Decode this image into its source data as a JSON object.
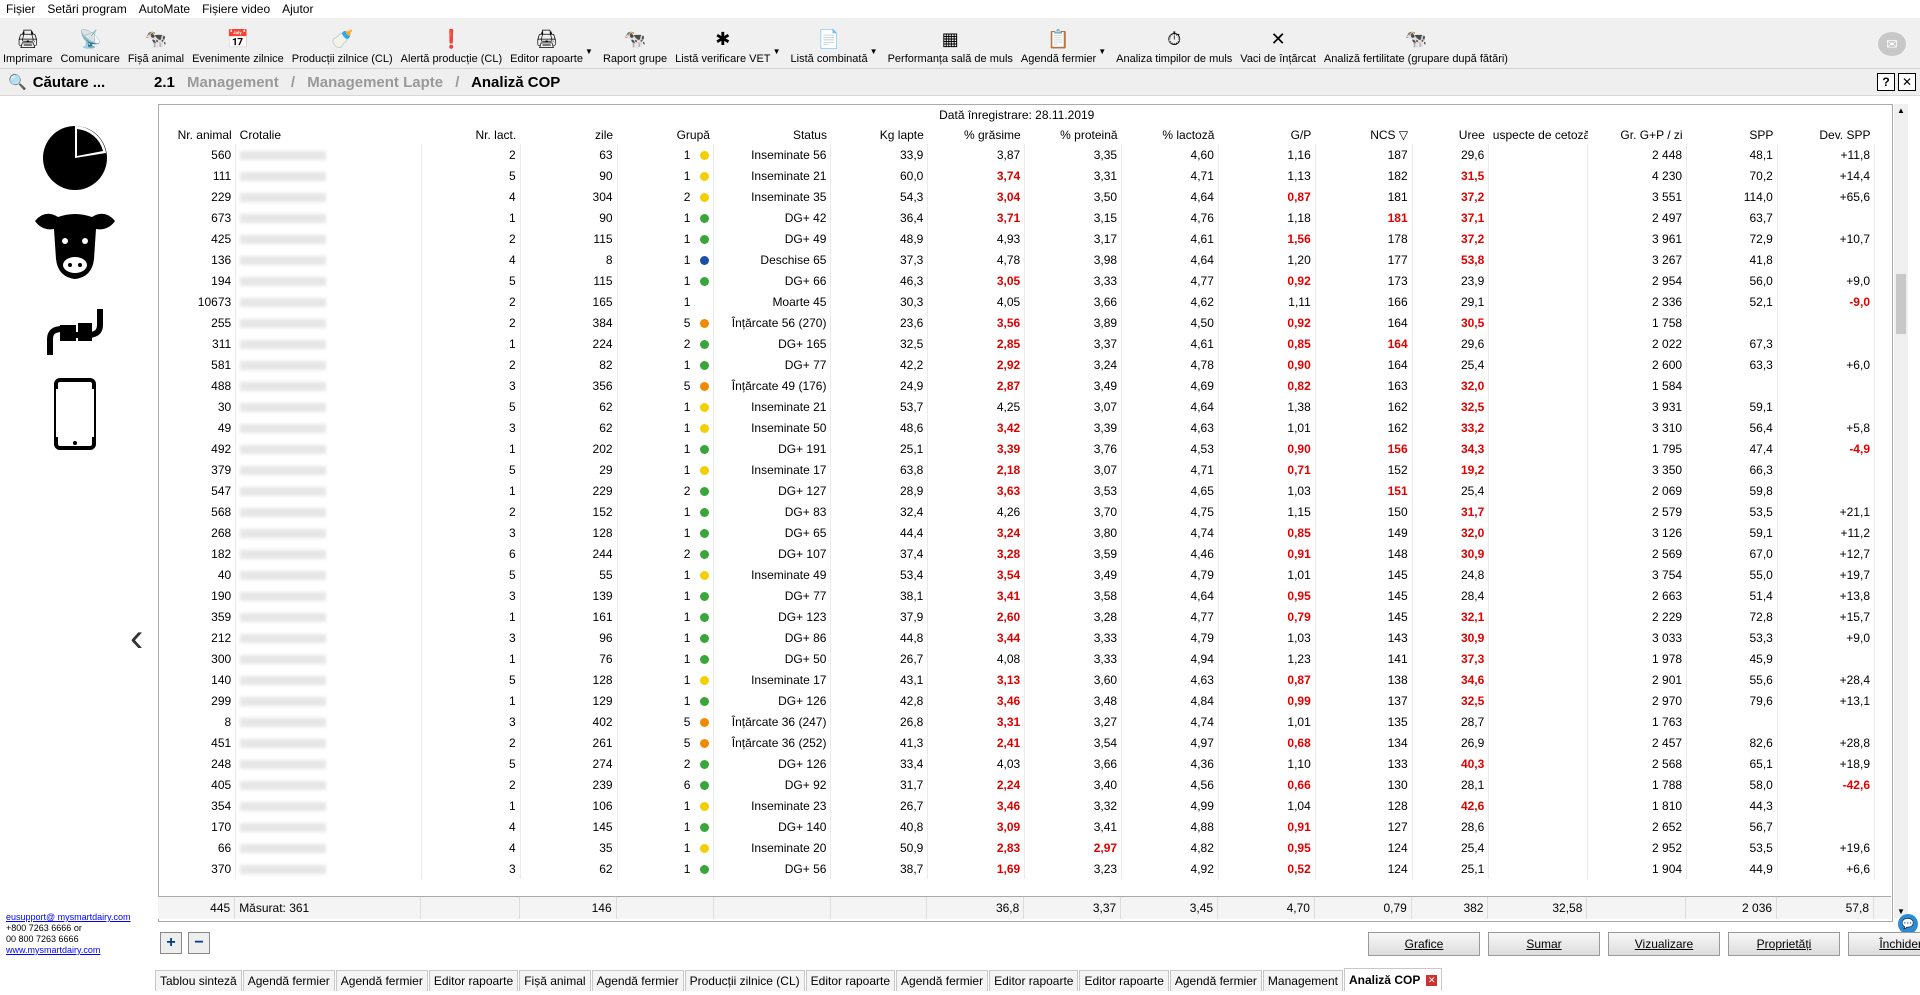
{
  "menu": [
    "Fișier",
    "Setări program",
    "AutoMate",
    "Fișiere video",
    "Ajutor"
  ],
  "toolbar": [
    {
      "label": "Imprimare",
      "icon": "printer-icon",
      "glyph": "🖨",
      "dd": false
    },
    {
      "label": "Comunicare",
      "icon": "antenna-icon",
      "glyph": "📡",
      "dd": false
    },
    {
      "label": "Fișă animal",
      "icon": "cow-card-icon",
      "glyph": "🐄",
      "dd": false
    },
    {
      "label": "Evenimente zilnice",
      "icon": "calendar-icon",
      "glyph": "📅",
      "dd": false
    },
    {
      "label": "Producții zilnice (CL)",
      "icon": "milk-bottle-icon",
      "glyph": "🍼",
      "dd": false
    },
    {
      "label": "Alertă producție (CL)",
      "icon": "alert-bottle-icon",
      "glyph": "❗",
      "dd": false
    },
    {
      "label": "Editor rapoarte",
      "icon": "report-printer-icon",
      "glyph": "🖨",
      "dd": true
    },
    {
      "label": "Raport grupe",
      "icon": "group-report-icon",
      "glyph": "🐄",
      "dd": false
    },
    {
      "label": "Listă verificare VET",
      "icon": "vet-icon",
      "glyph": "✱",
      "dd": true
    },
    {
      "label": "Listă combinată",
      "icon": "combined-list-icon",
      "glyph": "📄",
      "dd": true
    },
    {
      "label": "Performanța sală de muls",
      "icon": "milking-parlor-icon",
      "glyph": "▦",
      "dd": false
    },
    {
      "label": "Agendă fermier",
      "icon": "agenda-icon",
      "glyph": "📋",
      "dd": true
    },
    {
      "label": "Analiza timpilor de muls",
      "icon": "milking-time-icon",
      "glyph": "⏱",
      "dd": false
    },
    {
      "label": "Vaci de înțărcat",
      "icon": "dry-off-icon",
      "glyph": "✕",
      "dd": false
    },
    {
      "label": "Analiză fertilitate (grupare după fătări)",
      "icon": "fertility-icon",
      "glyph": "🐄",
      "dd": false
    }
  ],
  "search": {
    "label": "Căutare ..."
  },
  "breadcrumb": {
    "num": "2.1",
    "items": [
      "Management",
      "Management Lapte"
    ],
    "current": "Analiză COP"
  },
  "window_buttons": {
    "help": "?",
    "close": "✕"
  },
  "support": {
    "email": "eusupport@ mysmartdairy.com",
    "phone1": "+800 7263 6666 or",
    "phone2": "00 800 7263 6666",
    "site": "www.mysmartdairy.com"
  },
  "grid": {
    "date_label": "Dată înregistrare: 28.11.2019",
    "columns": [
      "Nr. animal",
      "Crotalie",
      "Nr. lact.",
      "zile",
      "Grupă",
      "Status",
      "Kg lapte",
      "% grăsime",
      "% proteină",
      "% lactoză",
      "G/P",
      "NCS ▽",
      "Uree",
      "uspecte de cetoză",
      "Gr. G+P / zi",
      "SPP",
      "Dev. SPP"
    ],
    "rows": [
      [
        "560",
        "",
        "2",
        "63",
        "1",
        "Y",
        "Inseminate 56",
        "33,9",
        "3,87",
        "3,35",
        "4,60",
        "1,16",
        "187",
        "29,6",
        "2 448",
        "48,1",
        "+11,8"
      ],
      [
        "111",
        "",
        "5",
        "90",
        "1",
        "Y",
        "Inseminate 21",
        "60,0",
        "*3,74",
        "3,31",
        "4,71",
        "1,13",
        "182",
        "*31,5",
        "4 230",
        "70,2",
        "+14,4"
      ],
      [
        "229",
        "",
        "4",
        "304",
        "2",
        "Y",
        "Inseminate 35",
        "54,3",
        "*3,04",
        "3,50",
        "4,64",
        "*0,87",
        "181",
        "*37,2",
        "3 551",
        "114,0",
        "+65,6"
      ],
      [
        "673",
        "",
        "1",
        "90",
        "1",
        "G",
        "DG+ 42",
        "36,4",
        "*3,71",
        "3,15",
        "4,76",
        "1,18",
        "*181",
        "*37,1",
        "2 497",
        "63,7",
        ""
      ],
      [
        "425",
        "",
        "2",
        "115",
        "1",
        "G",
        "DG+ 49",
        "48,9",
        "4,93",
        "3,17",
        "4,61",
        "*1,56",
        "178",
        "*37,2",
        "3 961",
        "72,9",
        "+10,7"
      ],
      [
        "136",
        "",
        "4",
        "8",
        "1",
        "B",
        "Deschise 65",
        "37,3",
        "4,78",
        "3,98",
        "4,64",
        "1,20",
        "177",
        "*53,8",
        "3 267",
        "41,8",
        ""
      ],
      [
        "194",
        "",
        "5",
        "115",
        "1",
        "G",
        "DG+ 66",
        "46,3",
        "*3,05",
        "3,33",
        "4,77",
        "*0,92",
        "173",
        "23,9",
        "2 954",
        "56,0",
        "+9,0"
      ],
      [
        "10673",
        "",
        "2",
        "165",
        "1",
        "",
        "Moarte 45",
        "30,3",
        "4,05",
        "3,66",
        "4,62",
        "1,11",
        "166",
        "29,1",
        "2 336",
        "52,1",
        "*-9,0"
      ],
      [
        "255",
        "",
        "2",
        "384",
        "5",
        "O",
        "Înțărcate 56 (270)",
        "23,6",
        "*3,56",
        "3,89",
        "4,50",
        "*0,92",
        "164",
        "*30,5",
        "1 758",
        "",
        ""
      ],
      [
        "311",
        "",
        "1",
        "224",
        "2",
        "G",
        "DG+ 165",
        "32,5",
        "*2,85",
        "3,37",
        "4,61",
        "*0,85",
        "*164",
        "29,6",
        "2 022",
        "67,3",
        ""
      ],
      [
        "581",
        "",
        "2",
        "82",
        "1",
        "G",
        "DG+ 77",
        "42,2",
        "*2,92",
        "3,24",
        "4,78",
        "*0,90",
        "164",
        "25,4",
        "2 600",
        "63,3",
        "+6,0"
      ],
      [
        "488",
        "",
        "3",
        "356",
        "5",
        "O",
        "Înțărcate 49 (176)",
        "24,9",
        "*2,87",
        "3,49",
        "4,69",
        "*0,82",
        "163",
        "*32,0",
        "1 584",
        "",
        ""
      ],
      [
        "30",
        "",
        "5",
        "62",
        "1",
        "Y",
        "Inseminate 21",
        "53,7",
        "4,25",
        "3,07",
        "4,64",
        "1,38",
        "162",
        "*32,5",
        "3 931",
        "59,1",
        ""
      ],
      [
        "49",
        "",
        "3",
        "62",
        "1",
        "Y",
        "Inseminate 50",
        "48,6",
        "*3,42",
        "3,39",
        "4,63",
        "1,01",
        "162",
        "*33,2",
        "3 310",
        "56,4",
        "+5,8"
      ],
      [
        "492",
        "",
        "1",
        "202",
        "1",
        "G",
        "DG+ 191",
        "25,1",
        "*3,39",
        "3,76",
        "4,53",
        "*0,90",
        "*156",
        "*34,3",
        "1 795",
        "47,4",
        "*-4,9"
      ],
      [
        "379",
        "",
        "5",
        "29",
        "1",
        "Y",
        "Inseminate 17",
        "63,8",
        "*2,18",
        "3,07",
        "4,71",
        "*0,71",
        "152",
        "*19,2",
        "3 350",
        "66,3",
        ""
      ],
      [
        "547",
        "",
        "1",
        "229",
        "2",
        "G",
        "DG+ 127",
        "28,9",
        "*3,63",
        "3,53",
        "4,65",
        "1,03",
        "*151",
        "25,4",
        "2 069",
        "59,8",
        ""
      ],
      [
        "568",
        "",
        "2",
        "152",
        "1",
        "G",
        "DG+ 83",
        "32,4",
        "4,26",
        "3,70",
        "4,75",
        "1,15",
        "150",
        "*31,7",
        "2 579",
        "53,5",
        "+21,1"
      ],
      [
        "268",
        "",
        "3",
        "128",
        "1",
        "G",
        "DG+ 65",
        "44,4",
        "*3,24",
        "3,80",
        "4,74",
        "*0,85",
        "149",
        "*32,0",
        "3 126",
        "59,1",
        "+11,2"
      ],
      [
        "182",
        "",
        "6",
        "244",
        "2",
        "G",
        "DG+ 107",
        "37,4",
        "*3,28",
        "3,59",
        "4,46",
        "*0,91",
        "148",
        "*30,9",
        "2 569",
        "67,0",
        "+12,7"
      ],
      [
        "40",
        "",
        "5",
        "55",
        "1",
        "Y",
        "Inseminate 49",
        "53,4",
        "*3,54",
        "3,49",
        "4,79",
        "1,01",
        "145",
        "24,8",
        "3 754",
        "55,0",
        "+19,7"
      ],
      [
        "190",
        "",
        "3",
        "139",
        "1",
        "G",
        "DG+ 77",
        "38,1",
        "*3,41",
        "3,58",
        "4,64",
        "*0,95",
        "145",
        "28,4",
        "2 663",
        "51,4",
        "+13,8"
      ],
      [
        "359",
        "",
        "1",
        "161",
        "1",
        "G",
        "DG+ 123",
        "37,9",
        "*2,60",
        "3,28",
        "4,77",
        "*0,79",
        "145",
        "*32,1",
        "2 229",
        "72,8",
        "+15,7"
      ],
      [
        "212",
        "",
        "3",
        "96",
        "1",
        "G",
        "DG+ 86",
        "44,8",
        "*3,44",
        "3,33",
        "4,79",
        "1,03",
        "143",
        "*30,9",
        "3 033",
        "53,3",
        "+9,0"
      ],
      [
        "300",
        "",
        "1",
        "76",
        "1",
        "G",
        "DG+ 50",
        "26,7",
        "4,08",
        "3,33",
        "4,94",
        "1,23",
        "141",
        "*37,3",
        "1 978",
        "45,9",
        ""
      ],
      [
        "140",
        "",
        "5",
        "128",
        "1",
        "Y",
        "Inseminate 17",
        "43,1",
        "*3,13",
        "3,60",
        "4,63",
        "*0,87",
        "138",
        "*34,6",
        "2 901",
        "55,6",
        "+28,4"
      ],
      [
        "299",
        "",
        "1",
        "129",
        "1",
        "G",
        "DG+ 126",
        "42,8",
        "*3,46",
        "3,48",
        "4,84",
        "*0,99",
        "137",
        "*32,5",
        "2 970",
        "79,6",
        "+13,1"
      ],
      [
        "8",
        "",
        "3",
        "402",
        "5",
        "O",
        "Înțărcate 36 (247)",
        "26,8",
        "*3,31",
        "3,27",
        "4,74",
        "1,01",
        "135",
        "28,7",
        "1 763",
        "",
        ""
      ],
      [
        "451",
        "",
        "2",
        "261",
        "5",
        "O",
        "Înțărcate 36 (252)",
        "41,3",
        "*2,41",
        "3,54",
        "4,97",
        "*0,68",
        "134",
        "26,9",
        "2 457",
        "82,6",
        "+28,8"
      ],
      [
        "248",
        "",
        "5",
        "274",
        "2",
        "G",
        "DG+ 126",
        "33,4",
        "4,03",
        "3,66",
        "4,36",
        "1,10",
        "133",
        "*40,3",
        "2 568",
        "65,1",
        "+18,9"
      ],
      [
        "405",
        "",
        "2",
        "239",
        "6",
        "G",
        "DG+ 92",
        "31,7",
        "*2,24",
        "3,40",
        "4,56",
        "*0,66",
        "130",
        "28,1",
        "1 788",
        "58,0",
        "*-42,6"
      ],
      [
        "354",
        "",
        "1",
        "106",
        "1",
        "Y",
        "Inseminate 23",
        "26,7",
        "*3,46",
        "3,32",
        "4,99",
        "1,04",
        "128",
        "*42,6",
        "1 810",
        "44,3",
        ""
      ],
      [
        "170",
        "",
        "4",
        "145",
        "1",
        "G",
        "DG+ 140",
        "40,8",
        "*3,09",
        "3,41",
        "4,88",
        "*0,91",
        "127",
        "28,6",
        "2 652",
        "56,7",
        ""
      ],
      [
        "66",
        "",
        "4",
        "35",
        "1",
        "Y",
        "Inseminate 20",
        "50,9",
        "*2,83",
        "*2,97",
        "4,82",
        "*0,95",
        "124",
        "25,4",
        "2 952",
        "53,5",
        "+19,6"
      ],
      [
        "370",
        "",
        "3",
        "62",
        "1",
        "G",
        "DG+ 56",
        "38,7",
        "*1,69",
        "3,23",
        "4,92",
        "*0,52",
        "124",
        "25,1",
        "1 904",
        "44,9",
        "+6,6"
      ]
    ],
    "totals": [
      "445",
      "Măsurat: 361",
      "",
      "146",
      "",
      "",
      "",
      "36,8",
      "3,37",
      "3,45",
      "4,70",
      "0,79",
      "382",
      "32,58",
      "",
      "2 036",
      "57,8",
      ""
    ]
  },
  "status_colors": {
    "Y": "#f2d000",
    "G": "#3aa53a",
    "B": "#1c4fa8",
    "O": "#f08a00"
  },
  "actions": {
    "add": "+",
    "remove": "−",
    "grafice": "Grafice",
    "sumar": "Sumar",
    "vizualizare": "Vizualizare",
    "proprietati": "Proprietăți",
    "inchidere": "Închidere"
  },
  "tabs": [
    "Tablou sinteză",
    "Agendă fermier",
    "Agendă fermier",
    "Editor rapoarte",
    "Fișă animal",
    "Agendă fermier",
    "Producții zilnice (CL)",
    "Editor rapoarte",
    "Agendă fermier",
    "Editor rapoarte",
    "Editor rapoarte",
    "Agendă fermier",
    "Management",
    "Analiză COP"
  ]
}
